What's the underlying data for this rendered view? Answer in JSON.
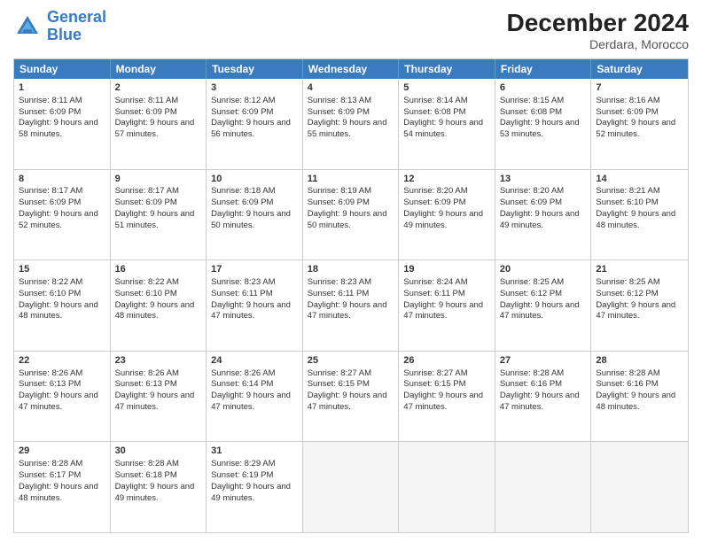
{
  "header": {
    "logo_line1": "General",
    "logo_line2": "Blue",
    "month_year": "December 2024",
    "location": "Derdara, Morocco"
  },
  "day_headers": [
    "Sunday",
    "Monday",
    "Tuesday",
    "Wednesday",
    "Thursday",
    "Friday",
    "Saturday"
  ],
  "weeks": [
    [
      {
        "num": "1",
        "sunrise": "8:11 AM",
        "sunset": "6:09 PM",
        "daylight": "9 hours and 58 minutes."
      },
      {
        "num": "2",
        "sunrise": "8:11 AM",
        "sunset": "6:09 PM",
        "daylight": "9 hours and 57 minutes."
      },
      {
        "num": "3",
        "sunrise": "8:12 AM",
        "sunset": "6:09 PM",
        "daylight": "9 hours and 56 minutes."
      },
      {
        "num": "4",
        "sunrise": "8:13 AM",
        "sunset": "6:09 PM",
        "daylight": "9 hours and 55 minutes."
      },
      {
        "num": "5",
        "sunrise": "8:14 AM",
        "sunset": "6:08 PM",
        "daylight": "9 hours and 54 minutes."
      },
      {
        "num": "6",
        "sunrise": "8:15 AM",
        "sunset": "6:08 PM",
        "daylight": "9 hours and 53 minutes."
      },
      {
        "num": "7",
        "sunrise": "8:16 AM",
        "sunset": "6:09 PM",
        "daylight": "9 hours and 52 minutes."
      }
    ],
    [
      {
        "num": "8",
        "sunrise": "8:17 AM",
        "sunset": "6:09 PM",
        "daylight": "9 hours and 52 minutes."
      },
      {
        "num": "9",
        "sunrise": "8:17 AM",
        "sunset": "6:09 PM",
        "daylight": "9 hours and 51 minutes."
      },
      {
        "num": "10",
        "sunrise": "8:18 AM",
        "sunset": "6:09 PM",
        "daylight": "9 hours and 50 minutes."
      },
      {
        "num": "11",
        "sunrise": "8:19 AM",
        "sunset": "6:09 PM",
        "daylight": "9 hours and 50 minutes."
      },
      {
        "num": "12",
        "sunrise": "8:20 AM",
        "sunset": "6:09 PM",
        "daylight": "9 hours and 49 minutes."
      },
      {
        "num": "13",
        "sunrise": "8:20 AM",
        "sunset": "6:09 PM",
        "daylight": "9 hours and 49 minutes."
      },
      {
        "num": "14",
        "sunrise": "8:21 AM",
        "sunset": "6:10 PM",
        "daylight": "9 hours and 48 minutes."
      }
    ],
    [
      {
        "num": "15",
        "sunrise": "8:22 AM",
        "sunset": "6:10 PM",
        "daylight": "9 hours and 48 minutes."
      },
      {
        "num": "16",
        "sunrise": "8:22 AM",
        "sunset": "6:10 PM",
        "daylight": "9 hours and 48 minutes."
      },
      {
        "num": "17",
        "sunrise": "8:23 AM",
        "sunset": "6:11 PM",
        "daylight": "9 hours and 47 minutes."
      },
      {
        "num": "18",
        "sunrise": "8:23 AM",
        "sunset": "6:11 PM",
        "daylight": "9 hours and 47 minutes."
      },
      {
        "num": "19",
        "sunrise": "8:24 AM",
        "sunset": "6:11 PM",
        "daylight": "9 hours and 47 minutes."
      },
      {
        "num": "20",
        "sunrise": "8:25 AM",
        "sunset": "6:12 PM",
        "daylight": "9 hours and 47 minutes."
      },
      {
        "num": "21",
        "sunrise": "8:25 AM",
        "sunset": "6:12 PM",
        "daylight": "9 hours and 47 minutes."
      }
    ],
    [
      {
        "num": "22",
        "sunrise": "8:26 AM",
        "sunset": "6:13 PM",
        "daylight": "9 hours and 47 minutes."
      },
      {
        "num": "23",
        "sunrise": "8:26 AM",
        "sunset": "6:13 PM",
        "daylight": "9 hours and 47 minutes."
      },
      {
        "num": "24",
        "sunrise": "8:26 AM",
        "sunset": "6:14 PM",
        "daylight": "9 hours and 47 minutes."
      },
      {
        "num": "25",
        "sunrise": "8:27 AM",
        "sunset": "6:15 PM",
        "daylight": "9 hours and 47 minutes."
      },
      {
        "num": "26",
        "sunrise": "8:27 AM",
        "sunset": "6:15 PM",
        "daylight": "9 hours and 47 minutes."
      },
      {
        "num": "27",
        "sunrise": "8:28 AM",
        "sunset": "6:16 PM",
        "daylight": "9 hours and 47 minutes."
      },
      {
        "num": "28",
        "sunrise": "8:28 AM",
        "sunset": "6:16 PM",
        "daylight": "9 hours and 48 minutes."
      }
    ],
    [
      {
        "num": "29",
        "sunrise": "8:28 AM",
        "sunset": "6:17 PM",
        "daylight": "9 hours and 48 minutes."
      },
      {
        "num": "30",
        "sunrise": "8:28 AM",
        "sunset": "6:18 PM",
        "daylight": "9 hours and 49 minutes."
      },
      {
        "num": "31",
        "sunrise": "8:29 AM",
        "sunset": "6:19 PM",
        "daylight": "9 hours and 49 minutes."
      },
      null,
      null,
      null,
      null
    ]
  ]
}
